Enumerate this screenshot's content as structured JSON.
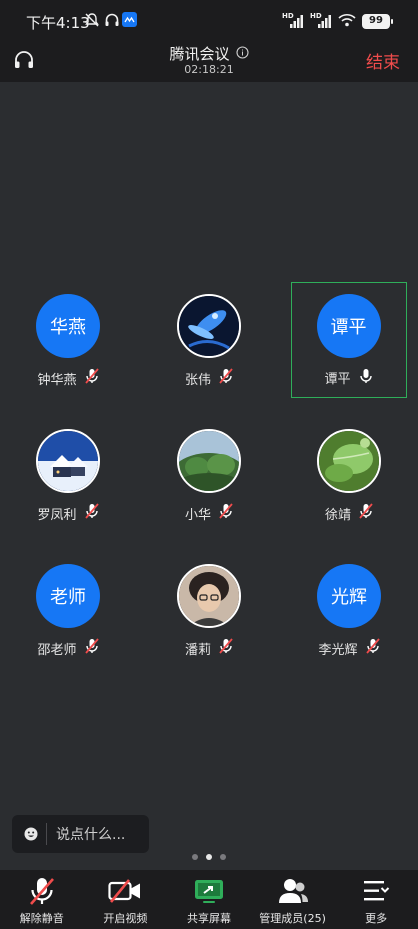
{
  "status_bar": {
    "time": "下午4:13",
    "battery": "99",
    "hd1": "HD",
    "hd2": "HD"
  },
  "header": {
    "title": "腾讯会议",
    "timer": "02:18:21",
    "end_label": "结束"
  },
  "participants": [
    {
      "name": "钟华燕",
      "avatar_text": "华燕",
      "avatar_type": "text",
      "mic": "muted"
    },
    {
      "name": "张伟",
      "avatar_type": "photo",
      "photo": "blue-fairy",
      "mic": "muted"
    },
    {
      "name": "谭平",
      "avatar_text": "谭平",
      "avatar_type": "text",
      "mic": "on",
      "speaking": true
    },
    {
      "name": "罗凤利",
      "avatar_type": "photo",
      "photo": "snow-house",
      "mic": "muted"
    },
    {
      "name": "小华",
      "avatar_type": "photo",
      "photo": "green-hill",
      "mic": "muted"
    },
    {
      "name": "徐靖",
      "avatar_type": "photo",
      "photo": "green-leaf",
      "mic": "muted"
    },
    {
      "name": "邵老师",
      "avatar_text": "老师",
      "avatar_type": "text",
      "mic": "muted"
    },
    {
      "name": "潘莉",
      "avatar_type": "photo",
      "photo": "girl-portrait",
      "mic": "muted"
    },
    {
      "name": "李光辉",
      "avatar_text": "光辉",
      "avatar_type": "text",
      "mic": "muted"
    }
  ],
  "chat": {
    "placeholder": "说点什么..."
  },
  "toolbar": [
    {
      "label": "解除静音",
      "icon": "mic-muted-icon"
    },
    {
      "label": "开启视频",
      "icon": "video-off-icon"
    },
    {
      "label": "共享屏幕",
      "icon": "share-screen-icon"
    },
    {
      "label": "管理成员(25)",
      "icon": "members-icon"
    },
    {
      "label": "更多",
      "icon": "more-icon"
    }
  ],
  "colors": {
    "accent": "#1677f5",
    "end": "#f04c4c",
    "share": "#2fae5a",
    "active_border": "#2fae5a"
  }
}
